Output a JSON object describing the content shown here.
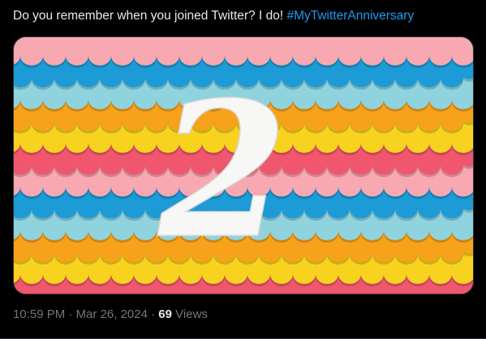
{
  "tweet": {
    "text": "Do you remember when you joined Twitter? I do! ",
    "hashtag": "#MyTwitterAnniversary",
    "media": {
      "number": "2",
      "band_colors": [
        "#f7a8b0",
        "#1c9bd6",
        "#8fd3df",
        "#f7a21b",
        "#f7d31f",
        "#f0566e",
        "#f7a8b0",
        "#1c9bd6",
        "#8fd3df",
        "#f7a21b",
        "#f7d31f",
        "#f0566e"
      ]
    }
  },
  "meta": {
    "time": "10:59 PM",
    "separator": " · ",
    "date": "Mar 26, 2024",
    "views_count": "69",
    "views_label": "Views"
  }
}
